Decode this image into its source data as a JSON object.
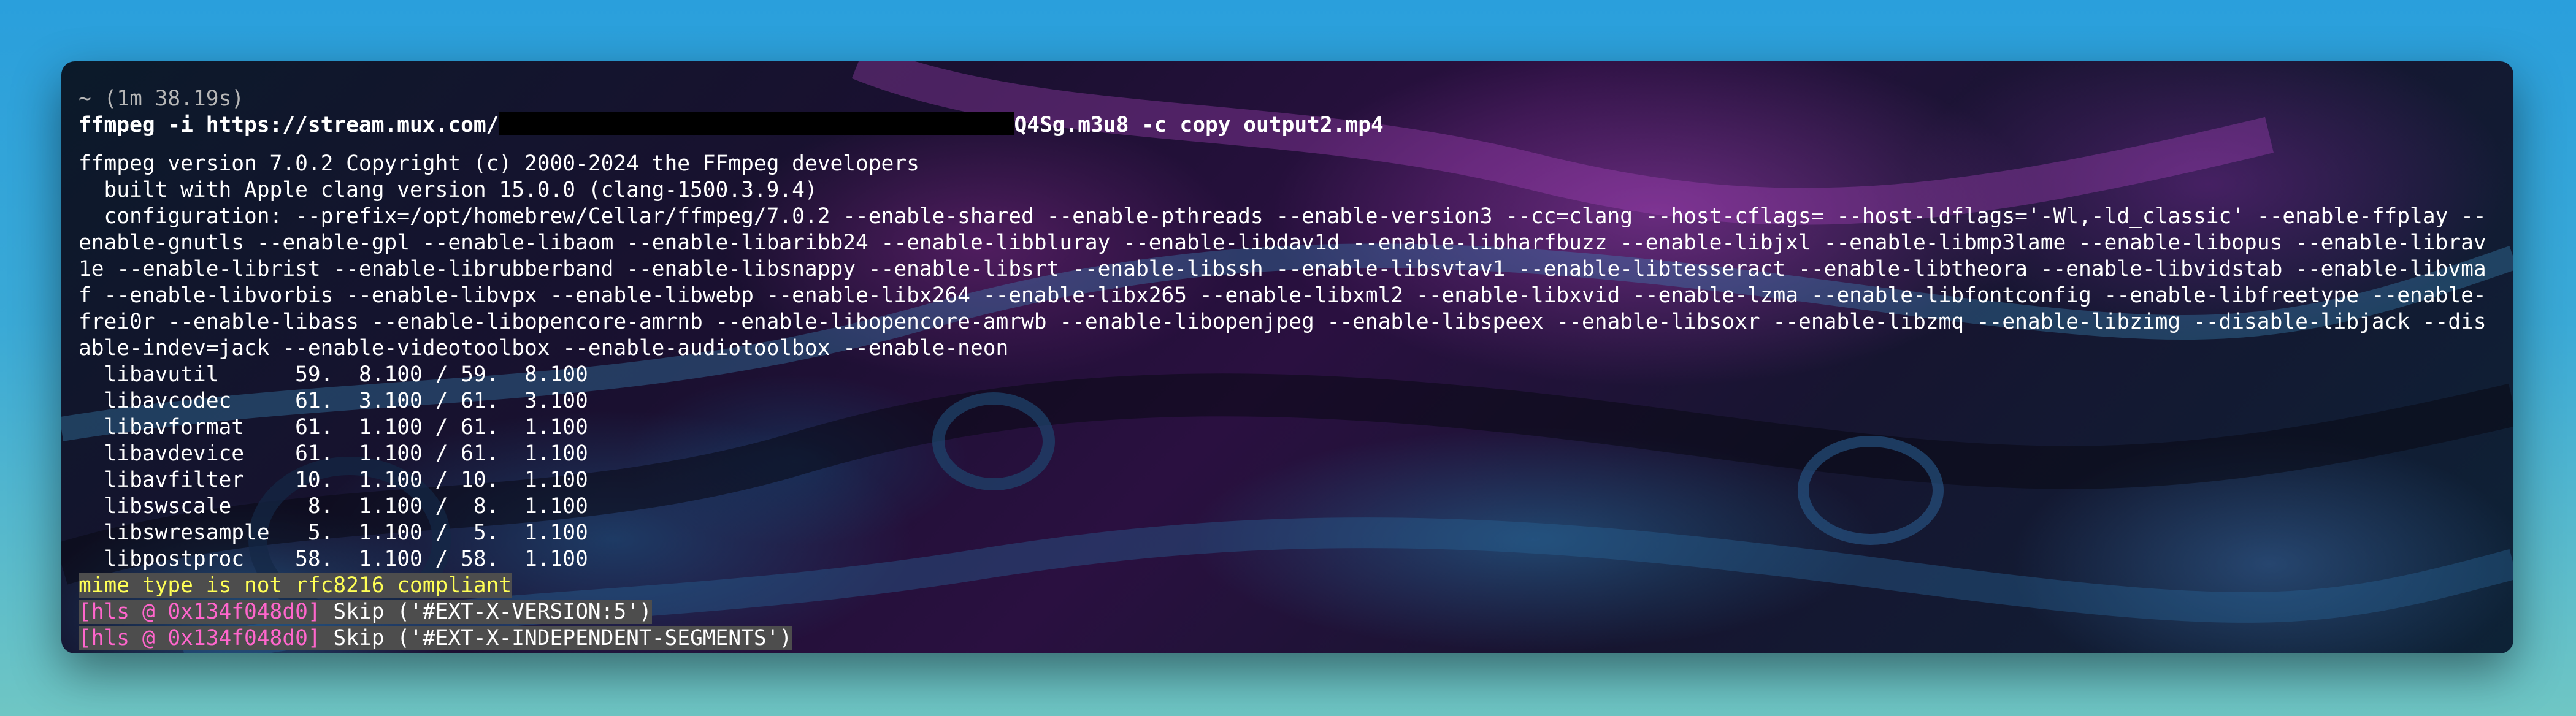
{
  "terminal": {
    "timing": "~ (1m 38.19s)",
    "command_prefix": "ffmpeg -i https://stream.mux.com/",
    "command_suffix": "Q4Sg.m3u8 -c copy output2.mp4",
    "version_line": "ffmpeg version 7.0.2 Copyright (c) 2000-2024 the FFmpeg developers",
    "built_line": "  built with Apple clang version 15.0.0 (clang-1500.3.9.4)",
    "configuration": "  configuration: --prefix=/opt/homebrew/Cellar/ffmpeg/7.0.2 --enable-shared --enable-pthreads --enable-version3 --cc=clang --host-cflags= --host-ldflags='-Wl,-ld_classic' --enable-ffplay --enable-gnutls --enable-gpl --enable-libaom --enable-libaribb24 --enable-libbluray --enable-libdav1d --enable-libharfbuzz --enable-libjxl --enable-libmp3lame --enable-libopus --enable-librav1e --enable-librist --enable-librubberband --enable-libsnappy --enable-libsrt --enable-libssh --enable-libsvtav1 --enable-libtesseract --enable-libtheora --enable-libvidstab --enable-libvmaf --enable-libvorbis --enable-libvpx --enable-libwebp --enable-libx264 --enable-libx265 --enable-libxml2 --enable-libxvid --enable-lzma --enable-libfontconfig --enable-libfreetype --enable-frei0r --enable-libass --enable-libopencore-amrnb --enable-libopencore-amrwb --enable-libopenjpeg --enable-libspeex --enable-libsoxr --enable-libzmq --enable-libzimg --disable-libjack --disable-indev=jack --enable-videotoolbox --enable-audiotoolbox --enable-neon",
    "libs": [
      "  libavutil      59.  8.100 / 59.  8.100",
      "  libavcodec     61.  3.100 / 61.  3.100",
      "  libavformat    61.  1.100 / 61.  1.100",
      "  libavdevice    61.  1.100 / 61.  1.100",
      "  libavfilter    10.  1.100 / 10.  1.100",
      "  libswscale      8.  1.100 /  8.  1.100",
      "  libswresample   5.  1.100 /  5.  1.100",
      "  libpostproc    58.  1.100 / 58.  1.100"
    ],
    "warning": "mime type is not rfc8216 compliant",
    "hls_lines": [
      {
        "tag": "[hls @ 0x134f048d0]",
        "msg": " Skip ('#EXT-X-VERSION:5')"
      },
      {
        "tag": "[hls @ 0x134f048d0]",
        "msg": " Skip ('#EXT-X-INDEPENDENT-SEGMENTS')"
      }
    ]
  }
}
